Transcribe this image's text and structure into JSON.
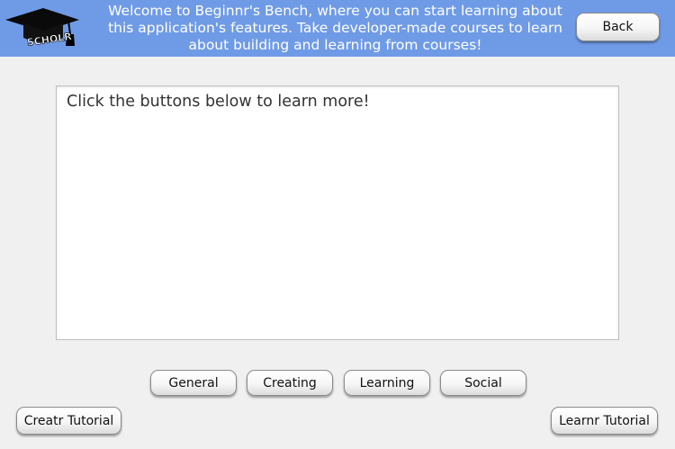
{
  "header": {
    "logo": {
      "icon": "graduation-cap-icon",
      "text": "SCHOLR"
    },
    "welcome_text": "Welcome to Beginnr's Bench, where you can start learning about this application's features. Take developer-made courses to learn about building and learning from courses!",
    "back_label": "Back"
  },
  "info_box": {
    "text": "Click the buttons below to learn more!"
  },
  "topics": [
    {
      "label": "General"
    },
    {
      "label": "Creating"
    },
    {
      "label": "Learning"
    },
    {
      "label": "Social"
    }
  ],
  "tutorials": {
    "creator_label": "Creatr Tutorial",
    "learner_label": "Learnr Tutorial"
  },
  "colors": {
    "header_bg": "#6f9be6",
    "window_bg": "#f0f0f0"
  }
}
